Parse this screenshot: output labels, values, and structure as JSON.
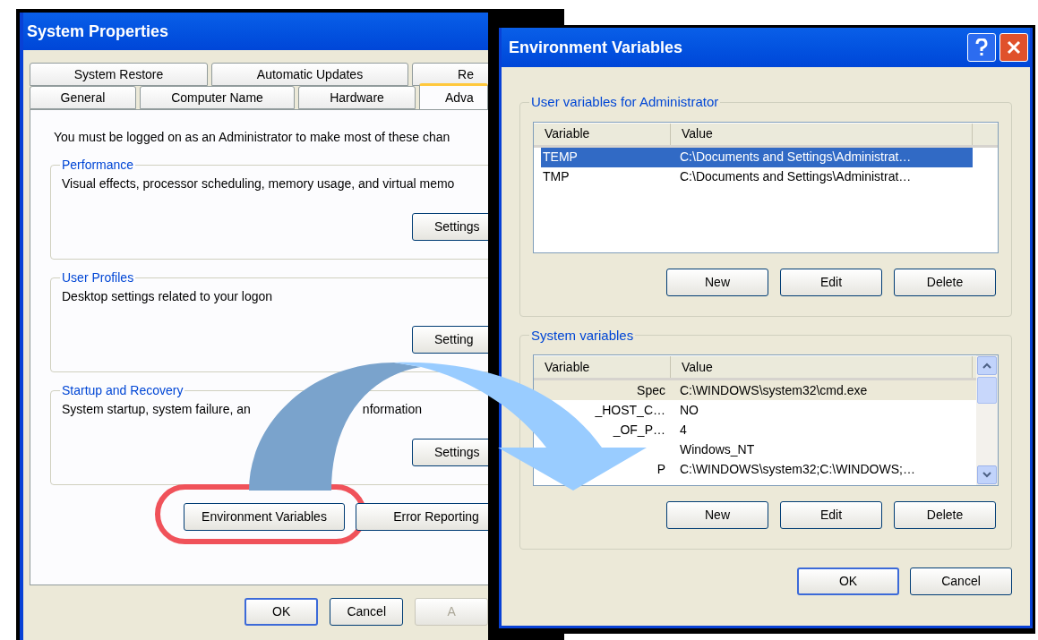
{
  "system_properties": {
    "title": "System Properties",
    "tabs_row_1": [
      {
        "label": "System Restore",
        "selected": false
      },
      {
        "label": "Automatic Updates",
        "selected": false
      },
      {
        "label": "Re",
        "selected": false
      }
    ],
    "tabs_row_2": [
      {
        "label": "General",
        "selected": false
      },
      {
        "label": "Computer Name",
        "selected": false
      },
      {
        "label": "Hardware",
        "selected": false
      },
      {
        "label": "Adva",
        "selected": true
      }
    ],
    "notice": "You must be logged on as an Administrator to make most of these chan",
    "groups": [
      {
        "title": "Performance",
        "description": [
          "Visual effects, processor scheduling, memory usage, and virtual memo"
        ],
        "button": "Settings"
      },
      {
        "title": "User Profiles",
        "description": [
          "Desktop settings related to your logon"
        ],
        "button": "Setting"
      },
      {
        "title": "Startup and Recovery",
        "description": [
          "System startup, system failure, an",
          "nformation"
        ],
        "button": "Settings"
      }
    ],
    "buttons": [
      {
        "label": "Environment Variables",
        "highlighted": true
      },
      {
        "label": "Error Reporting",
        "highlighted": false
      }
    ],
    "dialog_buttons": [
      {
        "label": "OK",
        "disabled": false,
        "default": true
      },
      {
        "label": "Cancel",
        "disabled": false,
        "default": false
      },
      {
        "label": "A",
        "disabled": true,
        "default": false
      }
    ]
  },
  "environment_variables": {
    "title": "Environment Variables",
    "groups": [
      {
        "title": "User variables for Administrator",
        "focused": true,
        "scrollable": false,
        "columns": [
          "Variable",
          "Value"
        ],
        "rows": [
          {
            "variable": "TEMP",
            "value": "C:\\Documents and Settings\\Administrat…",
            "selected": true
          },
          {
            "variable": "TMP",
            "value": "C:\\Documents and Settings\\Administrat…",
            "selected": false
          }
        ],
        "buttons": [
          "New",
          "Edit",
          "Delete"
        ]
      },
      {
        "title": "System variables",
        "focused": false,
        "scrollable": true,
        "columns": [
          "Variable",
          "Value"
        ],
        "rows": [
          {
            "variable": "Spec",
            "value": "C:\\WINDOWS\\system32\\cmd.exe",
            "selected": true
          },
          {
            "variable": "_HOST_C…",
            "value": "NO",
            "selected": false
          },
          {
            "variable": "_OF_P…",
            "value": "4",
            "selected": false
          },
          {
            "value": "Windows_NT",
            "selected": false
          },
          {
            "variable": "P",
            "value": "C:\\WINDOWS\\system32;C:\\WINDOWS;…",
            "selected": false
          }
        ],
        "buttons": [
          "New",
          "Edit",
          "Delete"
        ]
      }
    ],
    "buttons": [
      {
        "label": "OK",
        "default": true
      },
      {
        "label": "Cancel",
        "default": false
      }
    ]
  }
}
